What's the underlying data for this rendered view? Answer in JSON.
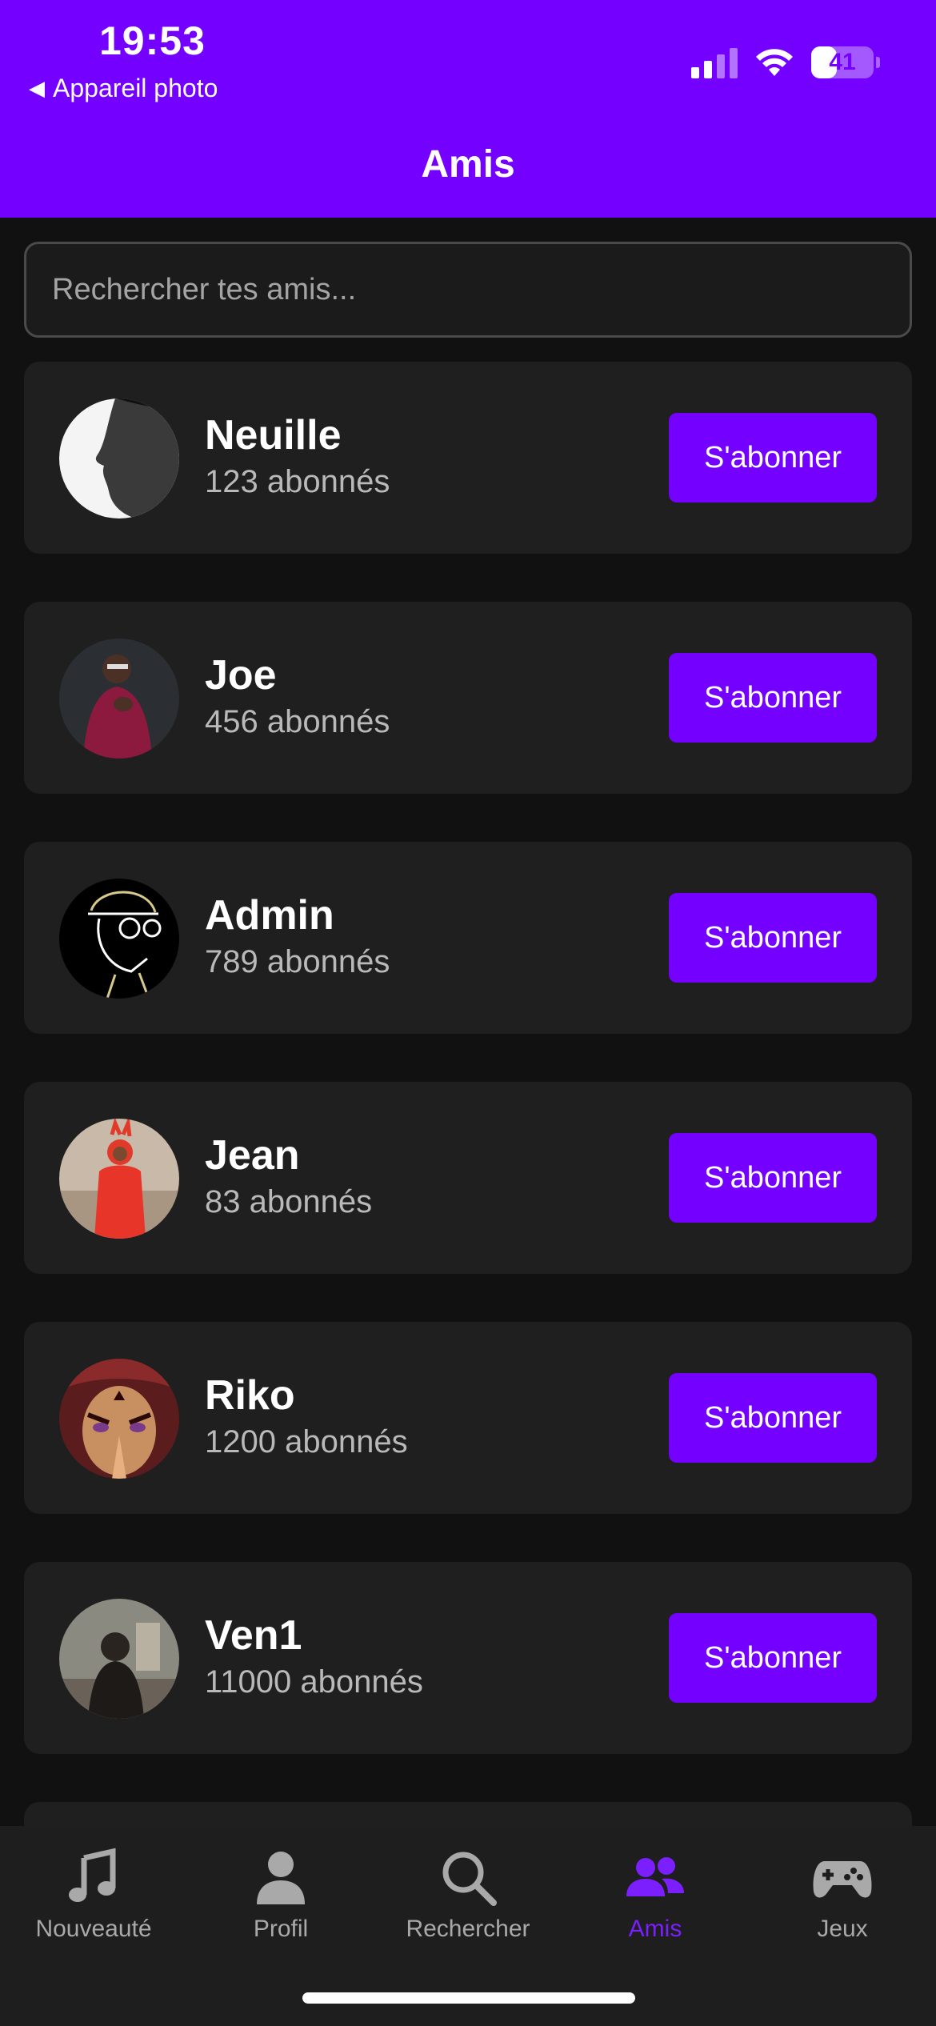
{
  "status_bar": {
    "time": "19:53",
    "back_label": "Appareil photo",
    "battery_level": "41"
  },
  "header": {
    "title": "Amis"
  },
  "search": {
    "placeholder": "Rechercher tes amis...",
    "value": ""
  },
  "friends": [
    {
      "name": "Neuille",
      "followers": "123 abonnés",
      "follow_label": "S'abonner",
      "avatar": "portrait-bw"
    },
    {
      "name": "Joe",
      "followers": "456 abonnés",
      "follow_label": "S'abonner",
      "avatar": "man-red-sweater"
    },
    {
      "name": "Admin",
      "followers": "789 abonnés",
      "follow_label": "S'abonner",
      "avatar": "line-drawing"
    },
    {
      "name": "Jean",
      "followers": "83 abonnés",
      "follow_label": "S'abonner",
      "avatar": "man-red-costume"
    },
    {
      "name": "Riko",
      "followers": "1200 abonnés",
      "follow_label": "S'abonner",
      "avatar": "anime-character"
    },
    {
      "name": "Ven1",
      "followers": "11000 abonnés",
      "follow_label": "S'abonner",
      "avatar": "silhouette-outdoor"
    }
  ],
  "tabs": [
    {
      "label": "Nouveauté",
      "icon": "music-note-icon",
      "active": false
    },
    {
      "label": "Profil",
      "icon": "person-icon",
      "active": false
    },
    {
      "label": "Rechercher",
      "icon": "search-icon",
      "active": false
    },
    {
      "label": "Amis",
      "icon": "friends-icon",
      "active": true
    },
    {
      "label": "Jeux",
      "icon": "gamepad-icon",
      "active": false
    }
  ],
  "colors": {
    "accent": "#7400ff",
    "background": "#111111",
    "card": "#1f1f1f",
    "tab_inactive": "#a9a9a9"
  }
}
